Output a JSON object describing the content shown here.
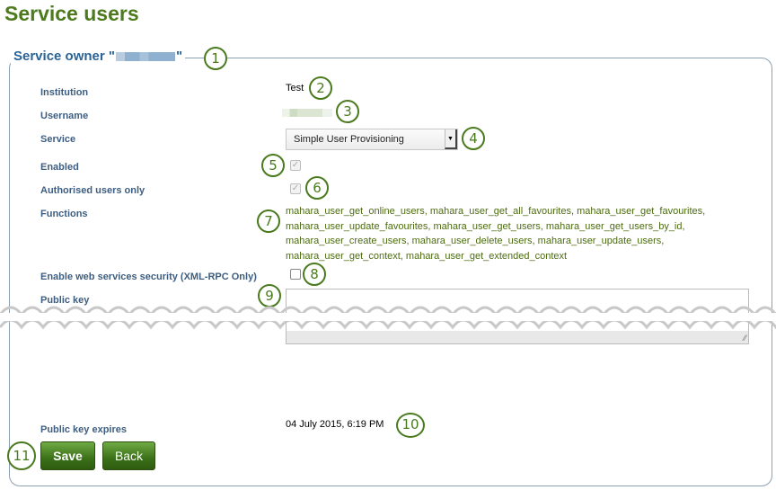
{
  "page": {
    "title": "Service users"
  },
  "fieldset": {
    "legend_prefix": "Service owner \"",
    "legend_suffix": "\""
  },
  "form": {
    "institution": {
      "label": "Institution",
      "value": "Test"
    },
    "username": {
      "label": "Username"
    },
    "service": {
      "label": "Service",
      "selected": "Simple User Provisioning"
    },
    "enabled": {
      "label": "Enabled",
      "checked": true,
      "disabled": true
    },
    "authorised_only": {
      "label": "Authorised users only",
      "checked": true,
      "disabled": true
    },
    "functions": {
      "label": "Functions",
      "value": "mahara_user_get_online_users, mahara_user_get_all_favourites, mahara_user_get_favourites, mahara_user_update_favourites, mahara_user_get_users, mahara_user_get_users_by_id, mahara_user_create_users, mahara_user_delete_users, mahara_user_update_users, mahara_user_get_context, mahara_user_get_extended_context"
    },
    "ws_security": {
      "label": "Enable web services security (XML-RPC Only)",
      "checked": false
    },
    "public_key": {
      "label": "Public key",
      "value": ""
    },
    "public_key_expires": {
      "label": "Public key expires",
      "value": "04 July 2015, 6:19 PM"
    }
  },
  "buttons": {
    "save": "Save",
    "back": "Back"
  },
  "callouts": [
    "1",
    "2",
    "3",
    "4",
    "5",
    "6",
    "7",
    "8",
    "9",
    "10",
    "11"
  ],
  "colors": {
    "title": "#4d7a1c",
    "label": "#3d5e80",
    "legend": "#2a6496",
    "functions": "#4d6b12",
    "button": "#3b7018",
    "callout": "#4a7a1e"
  }
}
